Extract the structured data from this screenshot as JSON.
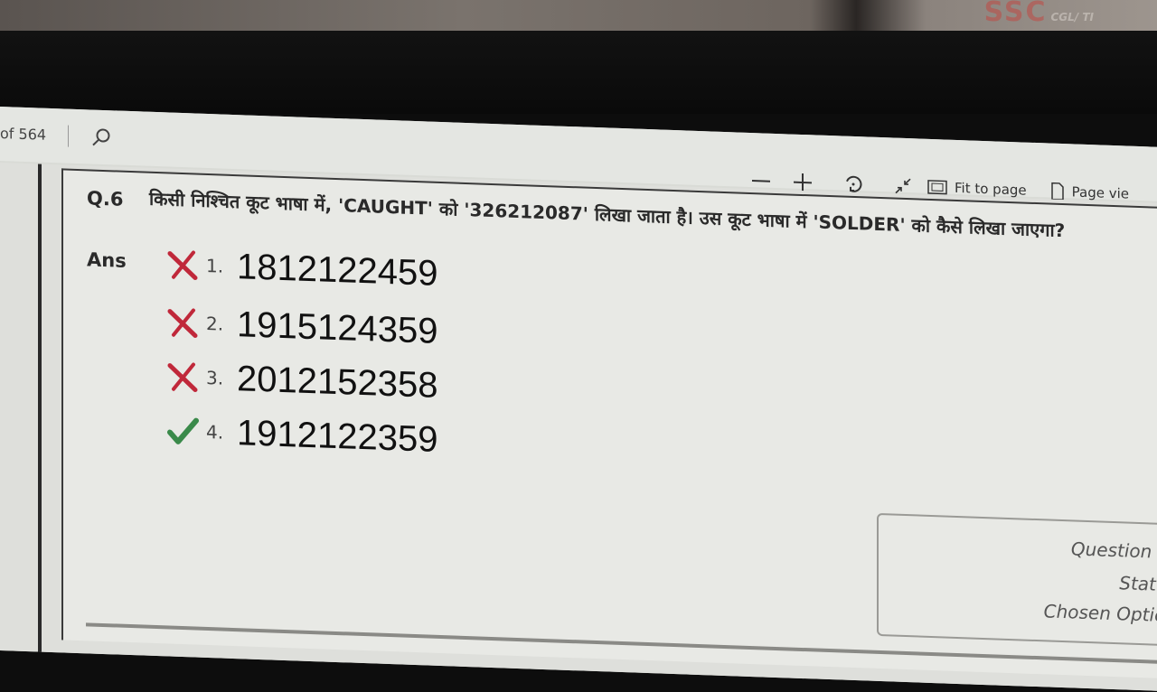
{
  "toolbar": {
    "page_count_text": "of 564",
    "fit_to_page_label": "Fit to page",
    "page_view_label": "Page vie"
  },
  "background": {
    "logo_text": "SSC",
    "logo_subtext": "CGL/ TI"
  },
  "question": {
    "number": "Q.6",
    "text": "किसी निश्चित कूट भाषा में, 'CAUGHT' को '326212087' लिखा जाता है। उस कूट भाषा में 'SOLDER' को कैसे लिखा जाएगा?",
    "answer_label": "Ans",
    "options": [
      {
        "number": "1.",
        "value": "1812122459",
        "status": "wrong"
      },
      {
        "number": "2.",
        "value": "1915124359",
        "status": "wrong"
      },
      {
        "number": "3.",
        "value": "2012152358",
        "status": "wrong"
      },
      {
        "number": "4.",
        "value": "1912122359",
        "status": "correct"
      }
    ]
  },
  "info_panel": {
    "question_id_label": "Question ID",
    "status_label": "Status",
    "chosen_option_label": "Chosen Option"
  },
  "colors": {
    "wrong_mark": "#c0283a",
    "correct_mark": "#3a8a4a"
  }
}
